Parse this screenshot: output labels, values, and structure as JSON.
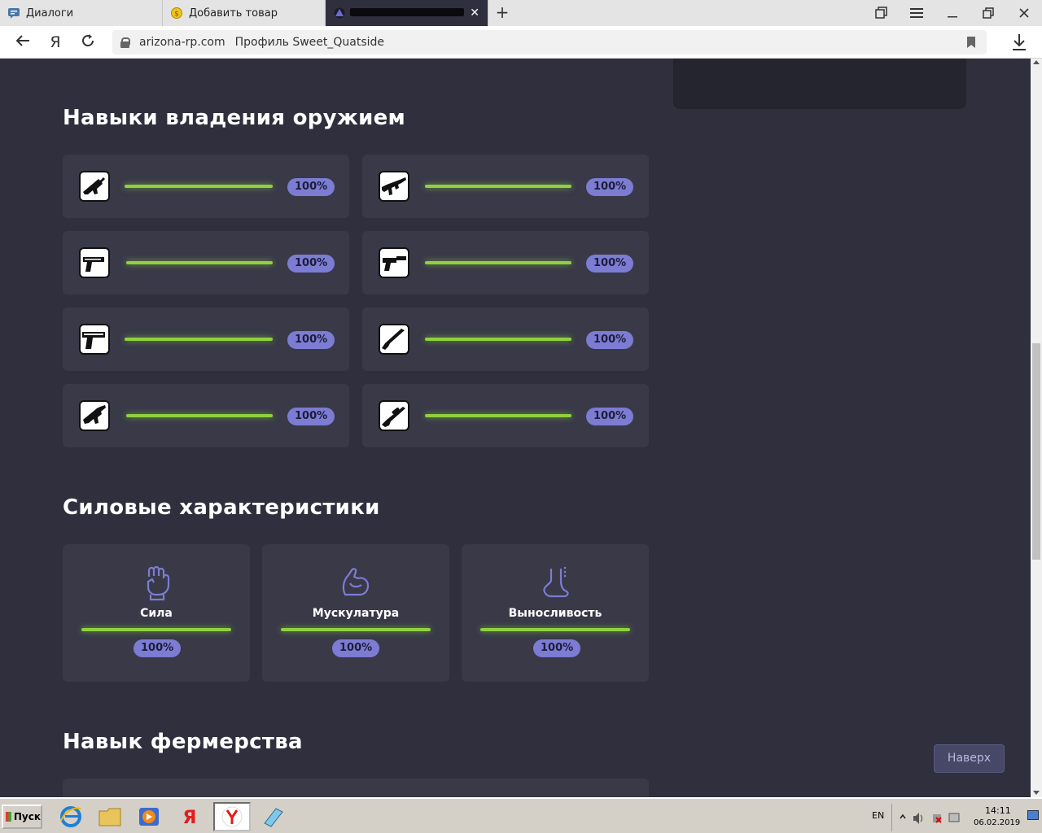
{
  "browser": {
    "tabs": [
      {
        "title": "Диалоги",
        "active": false
      },
      {
        "title": "Добавить товар",
        "active": false
      },
      {
        "title": "",
        "active": true
      }
    ],
    "address": {
      "host": "arizona-rp.com",
      "page_title": "Профиль Sweet_Quatside"
    }
  },
  "sections": {
    "weapons_title": "Навыки владения оружием",
    "strength_title": "Силовые характеристики",
    "farming_title": "Навык фермерства"
  },
  "weapons": [
    {
      "icon": "m4-rifle-icon",
      "value": "100%",
      "progress": 1.0
    },
    {
      "icon": "ak47-rifle-icon",
      "value": "100%",
      "progress": 1.0
    },
    {
      "icon": "pistol-icon",
      "value": "100%",
      "progress": 1.0
    },
    {
      "icon": "silenced-pistol-icon",
      "value": "100%",
      "progress": 1.0
    },
    {
      "icon": "desert-eagle-icon",
      "value": "100%",
      "progress": 1.0
    },
    {
      "icon": "shotgun-icon",
      "value": "100%",
      "progress": 1.0
    },
    {
      "icon": "smg-icon",
      "value": "100%",
      "progress": 1.0
    },
    {
      "icon": "sniper-rifle-icon",
      "value": "100%",
      "progress": 1.0
    }
  ],
  "stats": [
    {
      "label": "Сила",
      "icon": "fist-icon",
      "value": "100%",
      "progress": 1.0
    },
    {
      "label": "Мускулатура",
      "icon": "flexed-arm-icon",
      "value": "100%",
      "progress": 1.0
    },
    {
      "label": "Выносливость",
      "icon": "foot-icon",
      "value": "100%",
      "progress": 1.0
    }
  ],
  "scroll_top_label": "Наверх",
  "taskbar": {
    "start_label": "Пуск",
    "lang": "EN",
    "time": "14:11",
    "date": "06.02.2019"
  },
  "colors": {
    "page_bg": "#2f2f3d",
    "card_bg": "#393948",
    "progress": "#8fd13f",
    "badge": "#7c7cd3"
  }
}
